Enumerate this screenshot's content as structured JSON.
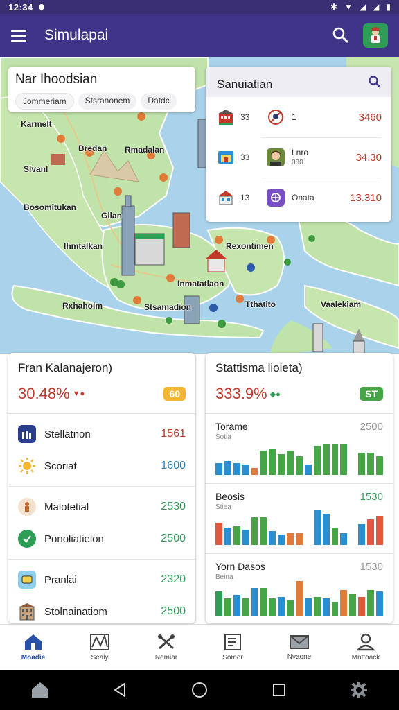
{
  "status_bar": {
    "time": "12:34"
  },
  "app_bar": {
    "title": "Simulapai"
  },
  "map": {
    "card_title": "Nar Ihoodsian",
    "chips": [
      "Jommeriam",
      "Stsranonem",
      "Datdc"
    ],
    "labels": [
      "Karmelt",
      "Bredan",
      "Rmadalan",
      "Slvanl",
      "Bosomitukan",
      "Gllan",
      "Ihmtalkan",
      "Rexontimen",
      "Inmatatlaon",
      "Rxhaholm",
      "Stsamadion",
      "Tthatito",
      "Vaalekiam"
    ]
  },
  "side_card": {
    "title": "Sanuiatian",
    "rows": [
      {
        "level": "33",
        "name": "1",
        "sub": "",
        "value": "3460"
      },
      {
        "level": "33",
        "name": "Lnro",
        "sub": "080",
        "value": "34.30"
      },
      {
        "level": "13",
        "name": "Onata",
        "sub": "",
        "value": "13.310"
      }
    ]
  },
  "panel_left": {
    "title": "Fran Kalanajeron)",
    "percent": "30.48%",
    "badge": "60",
    "items": [
      {
        "label": "Stellatnon",
        "value": "1561",
        "color": "#c0392b"
      },
      {
        "label": "Scoriat",
        "value": "1600",
        "color": "#2a7fb8"
      },
      {
        "label": "Malotetial",
        "value": "2530",
        "color": "#2e9e57"
      },
      {
        "label": "Ponoliatielon",
        "value": "2500",
        "color": "#2e9e57"
      },
      {
        "label": "Pranlai",
        "value": "2320",
        "color": "#2e9e57"
      },
      {
        "label": "Stolnainatiom",
        "value": "2500",
        "color": "#2e9e57"
      }
    ]
  },
  "panel_right": {
    "title": "Stattisma lioieta)",
    "percent": "333.9%",
    "badge": "ST",
    "charts": [
      {
        "title": "Torame",
        "sub": "Sotia",
        "value": "2500",
        "value_color": "#999999",
        "bars": [
          0.35,
          0.4,
          0.35,
          0.3,
          0.2,
          0.7,
          0.75,
          0.6,
          0.7,
          0.55,
          0.3,
          0.85,
          0.9,
          0.9,
          0.9,
          0.3,
          0.65,
          0.65,
          0.55
        ],
        "colors": [
          "#2a8fd0",
          "#2a8fd0",
          "#2a8fd0",
          "#2a8fd0",
          "#e07b39",
          "#46a546",
          "#46a546",
          "#46a546",
          "#46a546",
          "#46a546",
          "#2a8fd0",
          "#46a546",
          "#46a546",
          "#46a546",
          "#46a546",
          "#ffffff",
          "#46a546",
          "#46a546",
          "#46a546"
        ]
      },
      {
        "title": "Beosis",
        "sub": "Stiea",
        "value": "1530",
        "value_color": "#2e9e57",
        "bars": [
          0.65,
          0.5,
          0.55,
          0.45,
          0.8,
          0.8,
          0.4,
          0.3,
          0.35,
          0.35,
          0.2,
          1.0,
          0.9,
          0.5,
          0.35,
          0.2,
          0.6,
          0.75,
          0.85
        ],
        "colors": [
          "#e2583c",
          "#2a8fd0",
          "#46a546",
          "#2a8fd0",
          "#46a546",
          "#46a546",
          "#2a8fd0",
          "#2a8fd0",
          "#e07b39",
          "#e07b39",
          "#ffffff",
          "#2a8fd0",
          "#2a8fd0",
          "#46a546",
          "#2a8fd0",
          "#ffffff",
          "#2a8fd0",
          "#e2583c",
          "#e2583c"
        ]
      },
      {
        "title": "Yorn Dasos",
        "sub": "Beina",
        "value": "1530",
        "value_color": "#999999",
        "bars": [
          0.7,
          0.5,
          0.6,
          0.5,
          0.8,
          0.8,
          0.5,
          0.55,
          0.45,
          1.0,
          0.5,
          0.55,
          0.5,
          0.4,
          0.75,
          0.65,
          0.55,
          0.75,
          0.7
        ],
        "colors": [
          "#2e9e57",
          "#46a546",
          "#2a8fd0",
          "#46a546",
          "#2a8fd0",
          "#46a546",
          "#46a546",
          "#2a8fd0",
          "#46a546",
          "#e07b39",
          "#2a8fd0",
          "#46a546",
          "#2a8fd0",
          "#46a546",
          "#e07b39",
          "#46a546",
          "#e2583c",
          "#46a546",
          "#2a8fd0"
        ]
      }
    ]
  },
  "bottom_nav": [
    {
      "label": "Moadie",
      "active": true
    },
    {
      "label": "Sealy",
      "active": false
    },
    {
      "label": "Nemiar",
      "active": false
    },
    {
      "label": "Somor",
      "active": false
    },
    {
      "label": "Nvaone",
      "active": false
    },
    {
      "label": "Mnttoack",
      "active": false
    }
  ],
  "colors": {
    "app_bar": "#3f3488",
    "status_bar": "#3a2f73",
    "accent": "#2750a8",
    "sea": "#a9d3ea",
    "land": "#bfe3a8"
  }
}
